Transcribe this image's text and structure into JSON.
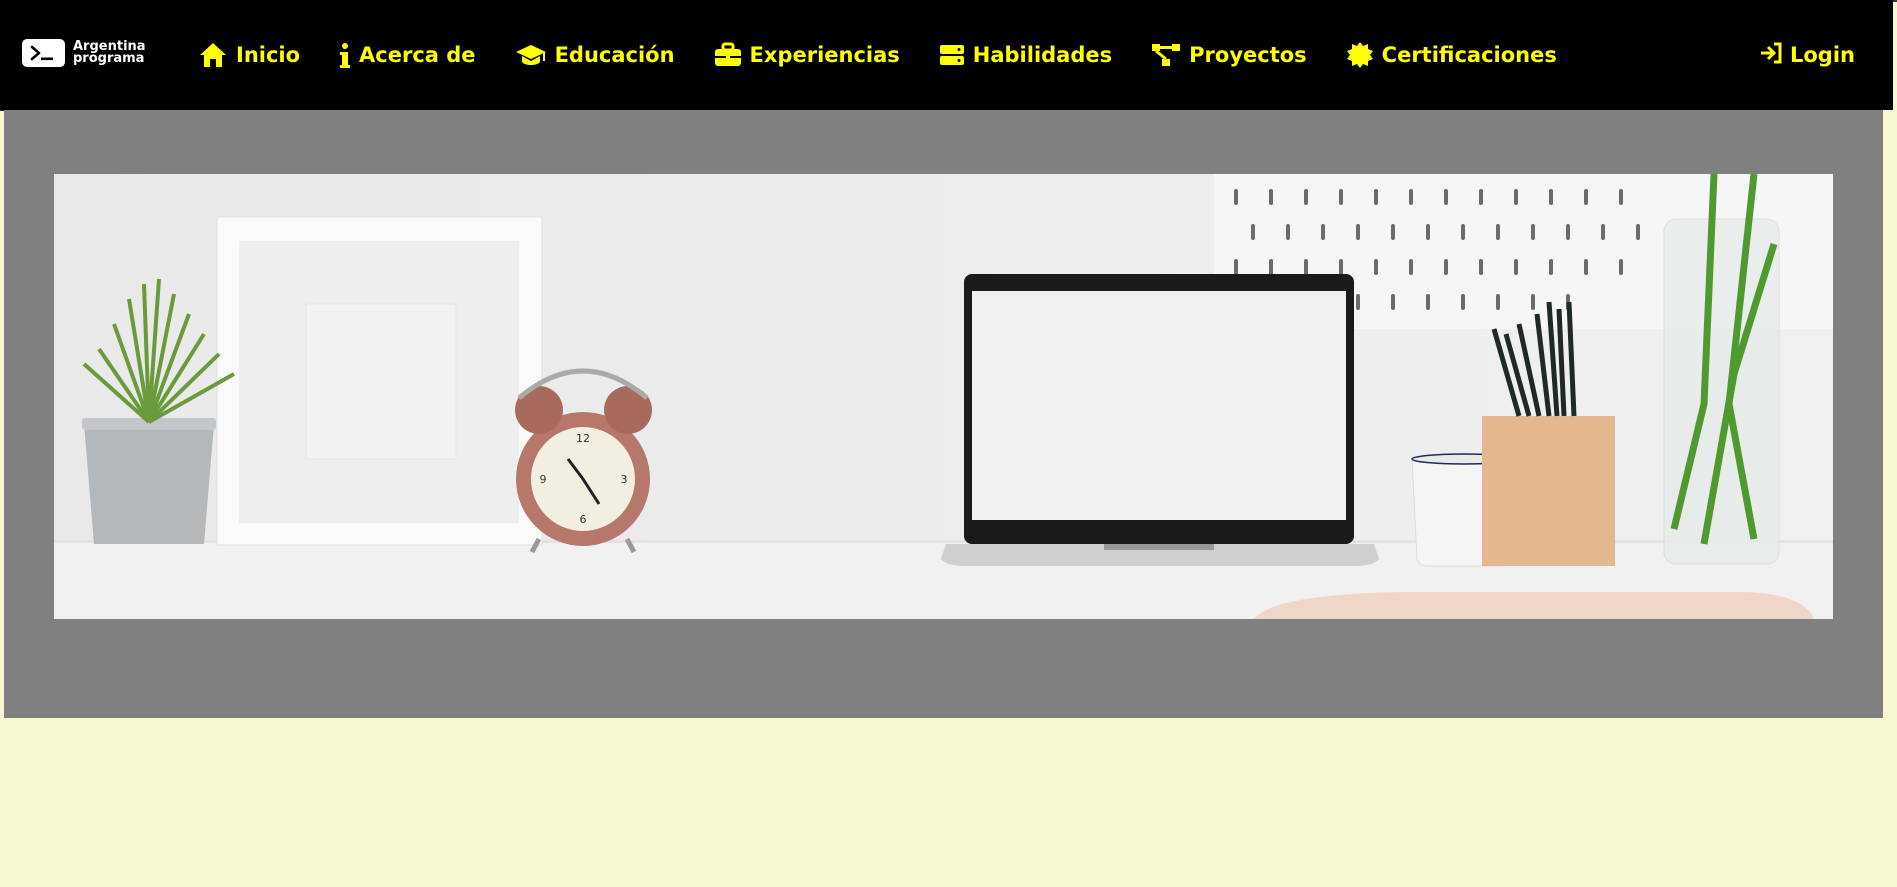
{
  "brand": {
    "logo_line1": "Argentina",
    "logo_line2": "programa"
  },
  "nav": {
    "items": [
      {
        "label": "Inicio",
        "icon": "home-icon"
      },
      {
        "label": "Acerca de",
        "icon": "info-icon"
      },
      {
        "label": "Educación",
        "icon": "graduation-cap-icon"
      },
      {
        "label": "Experiencias",
        "icon": "briefcase-icon"
      },
      {
        "label": "Habilidades",
        "icon": "server-icon"
      },
      {
        "label": "Proyectos",
        "icon": "project-diagram-icon"
      },
      {
        "label": "Certificaciones",
        "icon": "certificate-icon"
      }
    ],
    "login_label": "Login",
    "login_icon": "sign-in-icon"
  },
  "colors": {
    "nav_bg": "#000000",
    "nav_text": "#ffff00",
    "hero_bg": "#808080",
    "page_bg": "#f8f9d0"
  },
  "banner": {
    "subject": "desk-workspace-photo"
  }
}
